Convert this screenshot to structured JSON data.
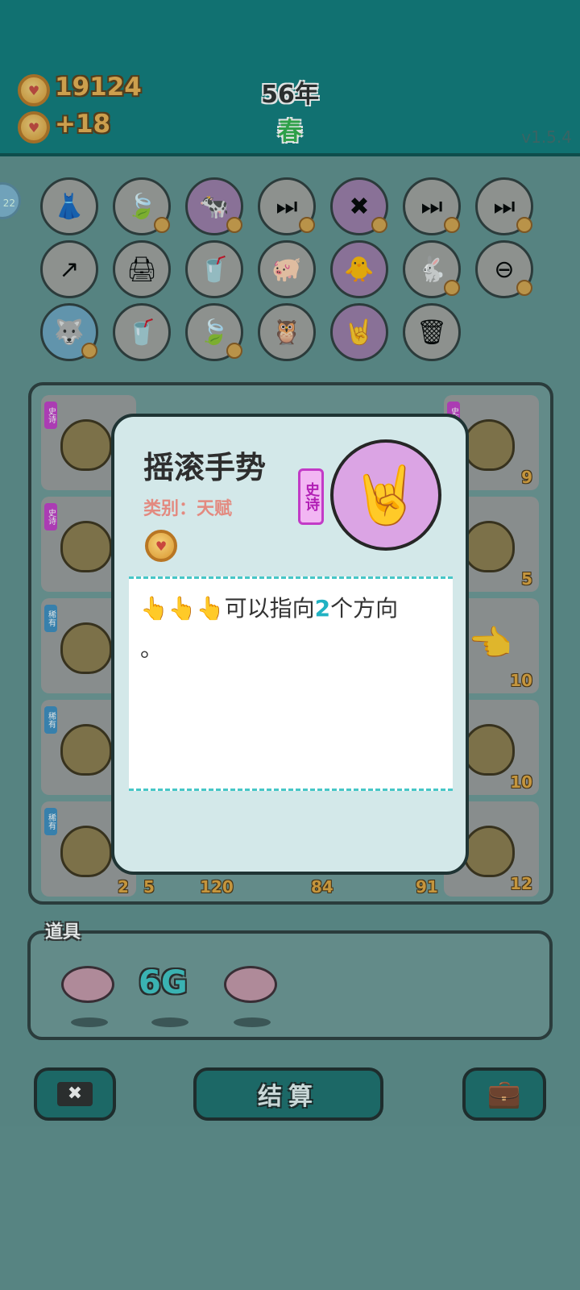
{
  "header": {
    "coins": "19124",
    "income": "+18",
    "year": "56年",
    "season": "春",
    "version": "v1.5.4"
  },
  "side_button": "22",
  "relics": {
    "row1": [
      "skirt-icon",
      "leaf-icon",
      "cow-icon",
      "skip-icon",
      "cancel-icon",
      "skip-icon",
      "skip-icon"
    ],
    "row2": [
      "arrow-card-icon",
      "printer-icon",
      "milk-tea-icon",
      "piggy-bank-icon",
      "chick-egg-icon",
      "rabbit-icon",
      "minus-icon"
    ],
    "row3": [
      "husky-icon",
      "milk-tea-icon",
      "leaf-icon",
      "owl-icon",
      "rock-hand-icon",
      "trash-bag-icon"
    ]
  },
  "board": {
    "cells": [
      {
        "tag": "史诗",
        "number": ""
      },
      {
        "tag": "史诗",
        "number": "9"
      },
      {
        "tag": "史诗",
        "number": "5"
      },
      {
        "tag": "稀有",
        "number": ""
      },
      {
        "tag": "",
        "number": "10"
      },
      {
        "tag": "稀有",
        "number": ""
      },
      {
        "tag": "",
        "number": "10"
      },
      {
        "tag": "稀有",
        "number": ""
      },
      {
        "tag": "",
        "number": "12"
      }
    ],
    "bottom_numbers": [
      "2",
      "5",
      "120",
      "84",
      "91"
    ]
  },
  "items": {
    "label": "道具",
    "g6_label": "6G"
  },
  "actions": {
    "settle_label": "结算"
  },
  "modal": {
    "title": "摇滚手势",
    "category": "类别：天赋",
    "rarity": "史诗",
    "desc_prefix": "可以指向",
    "desc_number": "2",
    "desc_suffix": "个方向",
    "desc_end": "。"
  },
  "colors": {
    "header_bg": "#0e7a79",
    "season": "#2fb14a",
    "rarity_epic": "#c23bc7",
    "highlight": "#21b2c2"
  }
}
